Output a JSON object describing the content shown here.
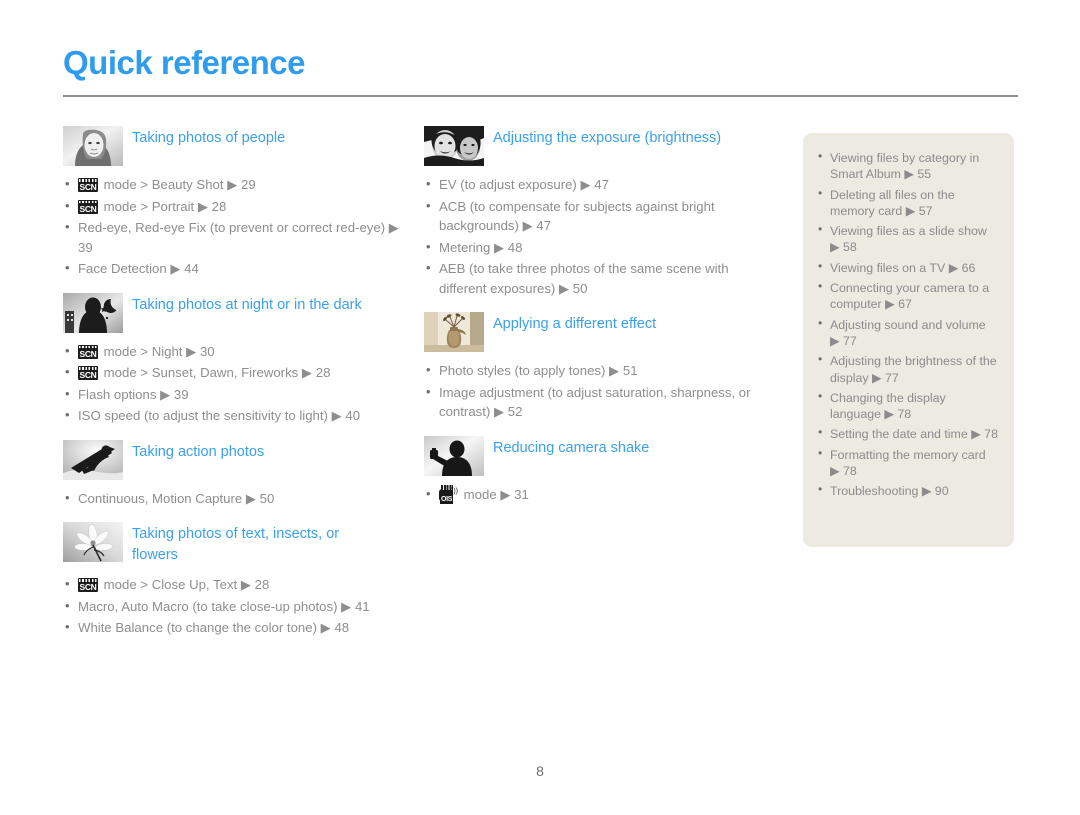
{
  "document": {
    "title": "Quick reference",
    "page_number": "8",
    "accent_color": "#3aa0ee",
    "body_text_color": "#8e8e8e",
    "sidebar_bg_color": "#edeae2"
  },
  "columns": [
    {
      "sections": [
        {
          "icon": "portrait-face-thumbnail",
          "title": "Taking photos of people",
          "items": [
            {
              "prefix_icon": "scn-mode-icon",
              "text": "mode > Beauty Shot ▶ 29"
            },
            {
              "prefix_icon": "scn-mode-icon",
              "text": "mode > Portrait ▶ 28"
            },
            {
              "prefix_icon": null,
              "text": "Red-eye, Red-eye Fix (to prevent or correct red-eye) ▶ 39"
            },
            {
              "prefix_icon": null,
              "text": "Face Detection ▶ 44"
            }
          ]
        },
        {
          "icon": "night-scene-thumbnail",
          "title": "Taking photos at night or in the dark",
          "items": [
            {
              "prefix_icon": "scn-mode-icon",
              "text": "mode > Night ▶ 30"
            },
            {
              "prefix_icon": "scn-mode-icon",
              "text": "mode > Sunset, Dawn, Fireworks ▶ 28"
            },
            {
              "prefix_icon": null,
              "text": "Flash options ▶ 39"
            },
            {
              "prefix_icon": null,
              "text": "ISO speed (to adjust the sensitivity to light) ▶ 40"
            }
          ]
        },
        {
          "icon": "snowboarder-thumbnail",
          "title": "Taking action photos",
          "items": [
            {
              "prefix_icon": null,
              "text": "Continuous, Motion Capture ▶ 50"
            }
          ]
        },
        {
          "icon": "flower-thumbnail",
          "title": "Taking photos of text, insects, or flowers",
          "items": [
            {
              "prefix_icon": "scn-mode-icon",
              "text": "mode > Close Up, Text ▶ 28"
            },
            {
              "prefix_icon": null,
              "text": "Macro, Auto Macro (to take close-up photos) ▶ 41"
            },
            {
              "prefix_icon": null,
              "text": "White Balance (to change the color tone) ▶ 48"
            }
          ]
        }
      ]
    },
    {
      "sections": [
        {
          "icon": "two-people-thumbnail",
          "title": "Adjusting the exposure (brightness)",
          "items": [
            {
              "prefix_icon": null,
              "text": "EV (to adjust exposure) ▶ 47"
            },
            {
              "prefix_icon": null,
              "text": "ACB (to compensate for subjects against bright backgrounds) ▶ 47"
            },
            {
              "prefix_icon": null,
              "text": "Metering ▶ 48"
            },
            {
              "prefix_icon": null,
              "text": "AEB (to take three photos of the same scene with different exposures) ▶ 50"
            }
          ]
        },
        {
          "icon": "sepia-vase-thumbnail",
          "title": "Applying a different effect",
          "items": [
            {
              "prefix_icon": null,
              "text": "Photo styles (to apply tones) ▶ 51"
            },
            {
              "prefix_icon": null,
              "text": "Image adjustment (to adjust saturation, sharpness, or contrast) ▶ 52"
            }
          ]
        },
        {
          "icon": "person-camera-thumbnail",
          "title": "Reducing camera shake",
          "items": [
            {
              "prefix_icon": "ois-mode-icon",
              "text": "mode ▶ 31"
            }
          ]
        }
      ]
    }
  ],
  "sidebar": {
    "items": [
      "Viewing files by category in Smart Album ▶ 55",
      "Deleting all files on the memory card ▶ 57",
      "Viewing files as a slide show ▶ 58",
      "Viewing files on a TV ▶ 66",
      "Connecting your camera to a computer ▶ 67",
      "Adjusting sound and volume ▶ 77",
      "Adjusting the brightness of the display ▶ 77",
      "Changing the display language ▶ 78",
      "Setting the date and time ▶ 78",
      "Formatting the memory card ▶ 78",
      "Troubleshooting ▶ 90"
    ]
  }
}
